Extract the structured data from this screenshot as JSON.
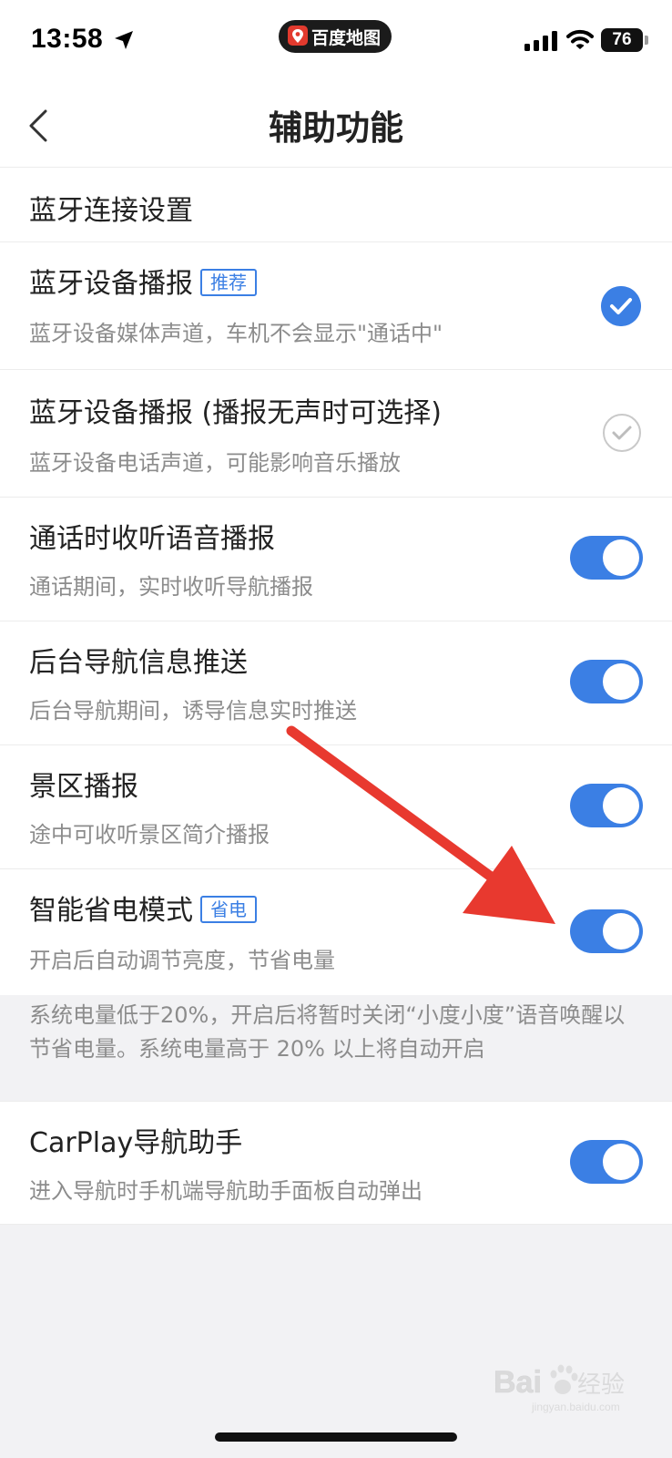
{
  "status_bar": {
    "time": "13:58",
    "app_name": "百度地图",
    "battery": "76"
  },
  "nav": {
    "title": "辅助功能"
  },
  "rows": [
    {
      "title": "蓝牙连接设置"
    },
    {
      "title": "蓝牙设备播报",
      "badge": "推荐",
      "subtitle": "蓝牙设备媒体声道，车机不会显示\"通话中\"",
      "selected": true
    },
    {
      "title": "蓝牙设备播报 (播报无声时可选择)",
      "subtitle": "蓝牙设备电话声道，可能影响音乐播放",
      "selected": false
    },
    {
      "title": "通话时收听语音播报",
      "subtitle": "通话期间，实时收听导航播报",
      "enabled": true
    },
    {
      "title": "后台导航信息推送",
      "subtitle": "后台导航期间，诱导信息实时推送",
      "enabled": true
    },
    {
      "title": "景区播报",
      "subtitle": "途中可收听景区简介播报",
      "enabled": true
    },
    {
      "title": "智能省电模式",
      "badge": "省电",
      "subtitle": "开启后自动调节亮度，节省电量",
      "enabled": true
    },
    {
      "title": "CarPlay导航助手",
      "subtitle": "进入导航时手机端导航助手面板自动弹出",
      "enabled": true
    }
  ],
  "power_note": "系统电量低于20%，开启后将暂时关闭“小度小度”语音唤醒以节省电量。系统电量高于 20% 以上将自动开启",
  "watermark": {
    "brand": "Bai du",
    "cn": "经验",
    "url": "jingyan.baidu.com"
  },
  "colors": {
    "accent": "#3b7fe4",
    "arrow": "#e8392f"
  }
}
